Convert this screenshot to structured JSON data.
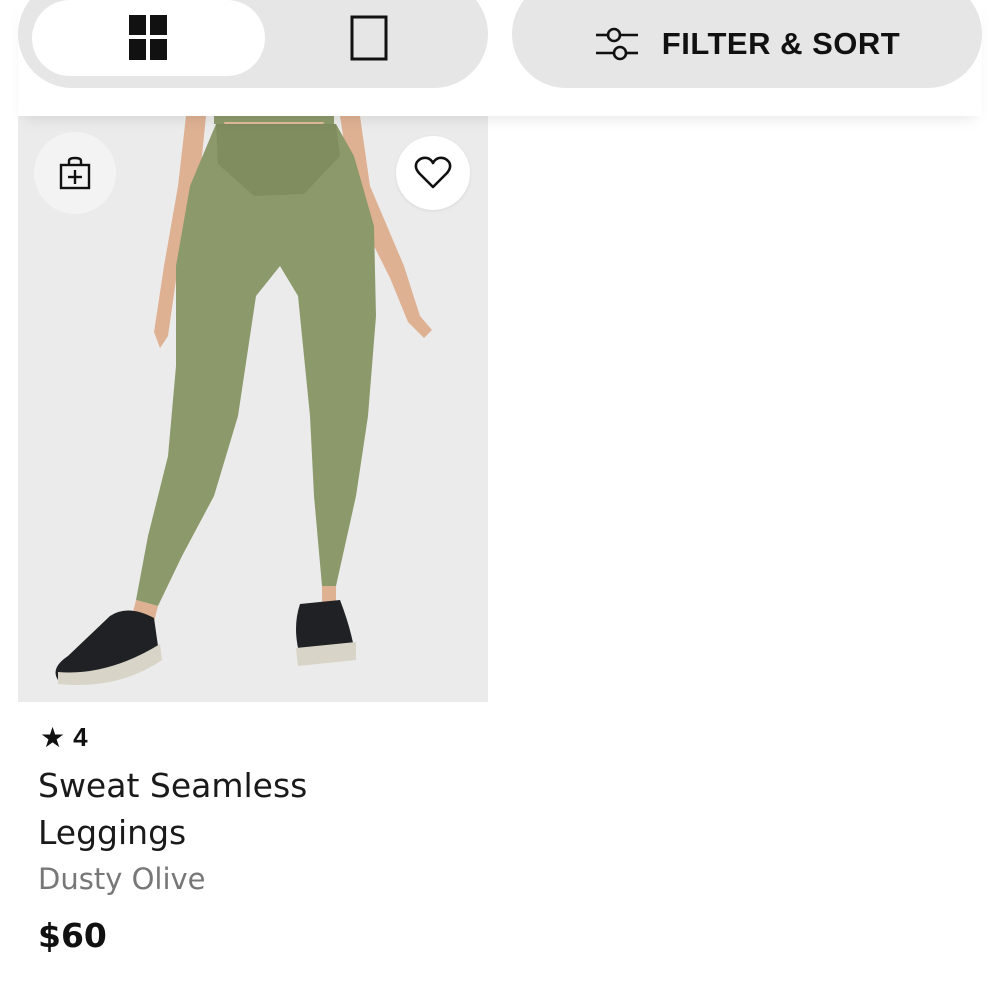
{
  "toolbar": {
    "view_options": [
      {
        "name": "grid-view",
        "icon": "grid-icon",
        "active": true
      },
      {
        "name": "single-view",
        "icon": "single-column-icon",
        "active": false
      }
    ],
    "filter_icon": "sliders-icon",
    "filter_label": "FILTER & SORT"
  },
  "product": {
    "image_alt": "Woman wearing olive green seamless leggings with black sneakers",
    "quick_add_icon": "bag-plus-icon",
    "wishlist_icon": "heart-icon",
    "rating_icon": "star-icon",
    "rating": "4",
    "name": "Sweat Seamless Leggings",
    "color": "Dusty Olive",
    "price": "$60"
  },
  "colors": {
    "toggle_bg": "#e6e6e6",
    "image_bg": "#ebebeb",
    "legging_olive": "#8c9a6b",
    "text_primary": "#111111",
    "text_secondary": "#777777"
  }
}
